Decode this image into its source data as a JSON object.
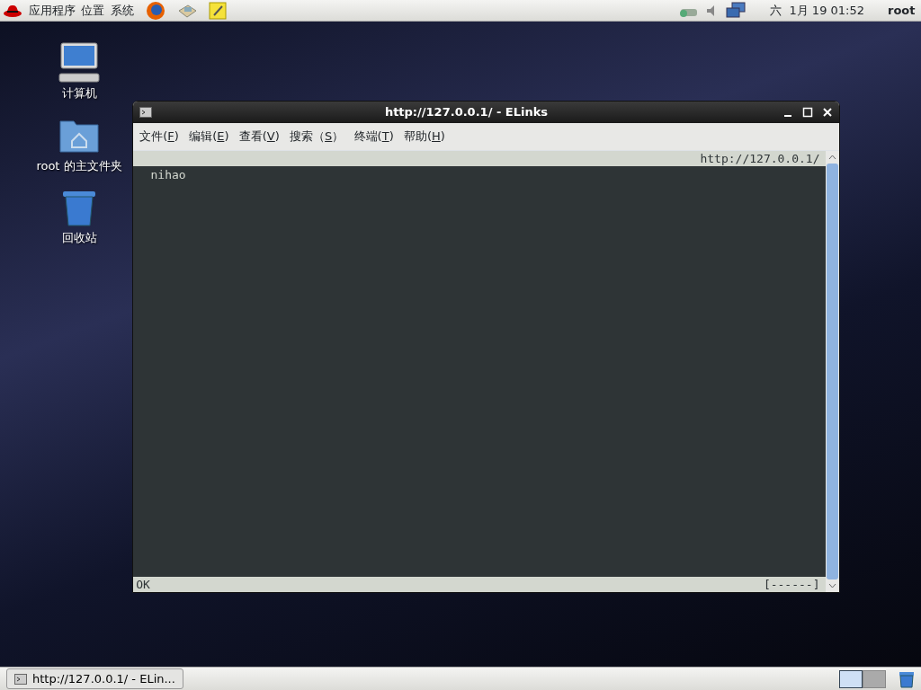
{
  "top_panel": {
    "menus": [
      {
        "label": "应用程序"
      },
      {
        "label": "位置"
      },
      {
        "label": "系统"
      }
    ],
    "clock": "六  1月 19 01:52",
    "user": "root"
  },
  "desktop_icons": [
    {
      "kind": "computer",
      "label": "计算机"
    },
    {
      "kind": "folder",
      "label": "root 的主文件夹"
    },
    {
      "kind": "trash",
      "label": "回收站"
    }
  ],
  "window": {
    "title": "http://127.0.0.1/ - ELinks",
    "menu": [
      {
        "before": "文件(",
        "access_key": "F",
        "after": ")"
      },
      {
        "before": "编辑(",
        "access_key": "E",
        "after": ")"
      },
      {
        "before": "查看(",
        "access_key": "V",
        "after": ")"
      },
      {
        "before": "搜索（",
        "access_key": "S",
        "after": "）"
      },
      {
        "before": "终端(",
        "access_key": "T",
        "after": ")"
      },
      {
        "before": "帮助(",
        "access_key": "H",
        "after": ")"
      }
    ],
    "url": "http://127.0.0.1/",
    "content": "nihao",
    "status": "OK",
    "progress": "[------]"
  },
  "taskbar": {
    "tasks": [
      {
        "label": "http://127.0.0.1/ - ELin...",
        "selected": false
      }
    ],
    "workspaces": [
      {
        "selected": true
      },
      {
        "selected": false
      }
    ]
  }
}
